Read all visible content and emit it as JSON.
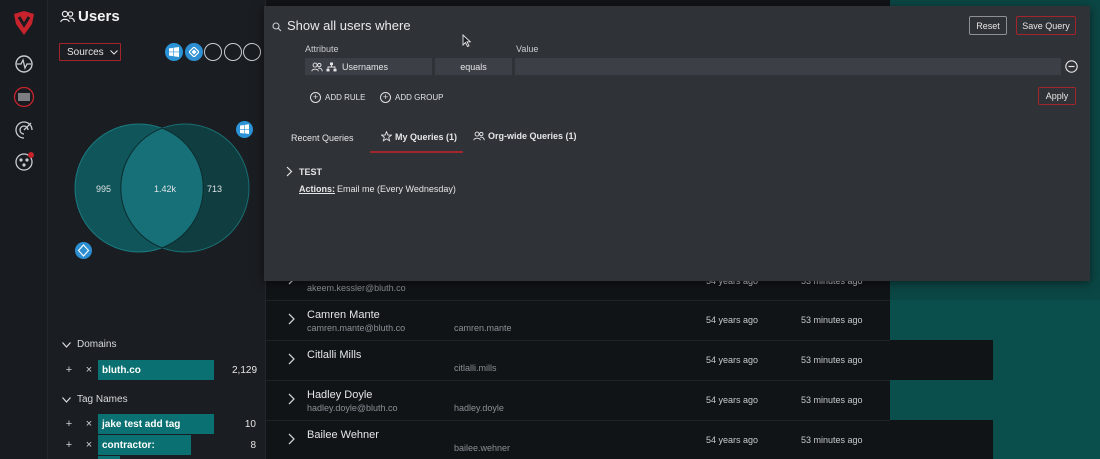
{
  "sidebar": {
    "title": "Users",
    "sources_label": "Sources",
    "venn": {
      "left": "995",
      "center": "1.42k",
      "right": "713"
    },
    "domains": {
      "heading": "Domains",
      "items": [
        {
          "label": "bluth.co",
          "count": "2,129",
          "fill": 0.95
        }
      ]
    },
    "tag_names": {
      "heading": "Tag Names",
      "items": [
        {
          "label": "jake test add tag",
          "count": "10",
          "fill": 0.8
        },
        {
          "label": "contractor:",
          "count": "8",
          "fill": 0.64
        }
      ]
    }
  },
  "query": {
    "title": "Show all users where",
    "reset_label": "Reset",
    "save_label": "Save Query",
    "attribute_header": "Attribute",
    "value_header": "Value",
    "attribute_value": "Usernames",
    "operator_value": "equals",
    "value_value": "",
    "add_rule_label": "ADD RULE",
    "add_group_label": "ADD GROUP",
    "apply_label": "Apply",
    "tabs": [
      "Recent Queries",
      "My Queries (1)",
      "Org-wide Queries (1)"
    ],
    "active_tab": "My Queries (1)",
    "saved": {
      "name": "TEST",
      "actions_label": "Actions:",
      "actions_text": "Email me (Every Wednesday)"
    }
  },
  "users": [
    {
      "name": "",
      "email": "akeem.kessler@bluth.co",
      "handle": "",
      "created": "54 years ago",
      "seen": "53 minutes ago"
    },
    {
      "name": "Camren Mante",
      "email": "camren.mante@bluth.co",
      "handle": "camren.mante",
      "created": "54 years ago",
      "seen": "53 minutes ago"
    },
    {
      "name": "Citlalli Mills",
      "email": "",
      "handle": "citlalli.mills",
      "created": "54 years ago",
      "seen": "53 minutes ago"
    },
    {
      "name": "Hadley Doyle",
      "email": "hadley.doyle@bluth.co",
      "handle": "hadley.doyle",
      "created": "54 years ago",
      "seen": "53 minutes ago"
    },
    {
      "name": "Bailee Wehner",
      "email": "",
      "handle": "bailee.wehner",
      "created": "54 years ago",
      "seen": "53 minutes ago"
    }
  ],
  "colors": {
    "accent": "#a3242b",
    "teal": "#0a7071",
    "panel": "#2f3236"
  }
}
